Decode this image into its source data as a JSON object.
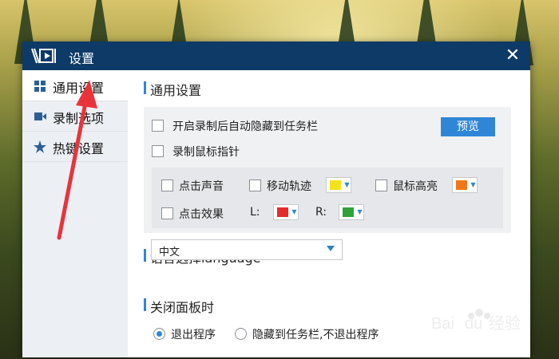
{
  "window": {
    "title": "设置",
    "close_glyph": "✕"
  },
  "sidebar": {
    "items": [
      {
        "label": "通用设置",
        "icon": "grid-icon"
      },
      {
        "label": "录制选项",
        "icon": "video-icon"
      },
      {
        "label": "热键设置",
        "icon": "star-icon"
      }
    ]
  },
  "general": {
    "title": "通用设置",
    "auto_hide_label": "开启录制后自动隐藏到任务栏",
    "record_cursor_label": "录制鼠标指针",
    "preview_button": "预览",
    "click_sound_label": "点击声音",
    "move_track_label": "移动轨迹",
    "cursor_highlight_label": "鼠标高亮",
    "click_effect_label": "点击效果",
    "left_label": "L:",
    "right_label": "R:"
  },
  "colors": {
    "move_track": "#f3e21a",
    "cursor_highlight": "#f0781a",
    "left_click": "#e52b2b",
    "right_click": "#2fa23a",
    "accent": "#2f86d6",
    "titlebar": "#0e3a68"
  },
  "language": {
    "title": "语言选择language",
    "selected": "中文"
  },
  "close_panel": {
    "title": "关闭面板时",
    "option_exit": "退出程序",
    "option_hide": "隐藏到任务栏,不退出程序",
    "selected": "退出程序"
  },
  "watermark": {
    "text": "Bai du 经验"
  }
}
